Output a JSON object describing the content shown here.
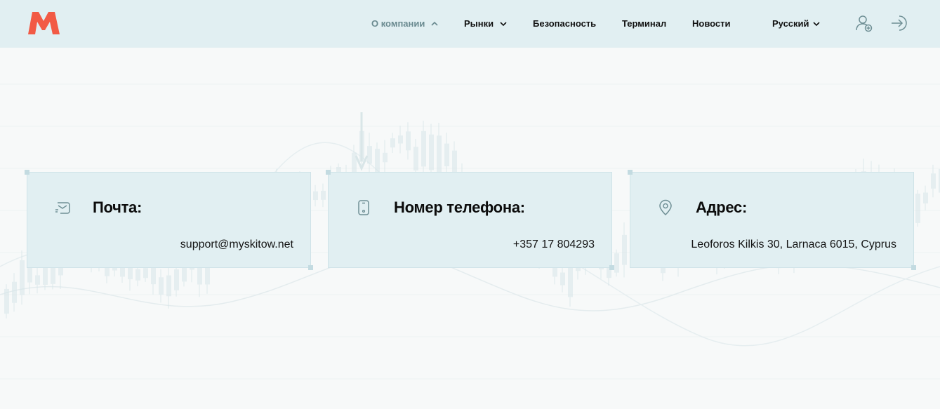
{
  "header": {
    "logo": "logo-m",
    "nav": [
      {
        "label": "О компании",
        "icon": "chevron-up-icon",
        "active": true
      },
      {
        "label": "Рынки",
        "icon": "chevron-down-icon"
      },
      {
        "label": "Безопасность"
      },
      {
        "label": "Терминал"
      },
      {
        "label": "Новости"
      }
    ],
    "language": {
      "label": "Русский",
      "icon": "chevron-down-icon"
    },
    "actions": [
      {
        "icon": "user-add-icon"
      },
      {
        "icon": "login-icon"
      }
    ]
  },
  "contacts": [
    {
      "icon": "mail-icon",
      "title": "Почта:",
      "value": "support@myskitow.net"
    },
    {
      "icon": "phone-icon",
      "title": "Номер телефона:",
      "value": "+357 17 804293"
    },
    {
      "icon": "location-pin-icon",
      "title": "Адрес:",
      "value": "Leoforos Kilkis 30, Larnaca 6015, Cyprus"
    }
  ],
  "colors": {
    "header_bg": "#e1eff2",
    "card_bg": "#e1eff2",
    "logo": "#f25a45",
    "active_nav": "#6a8a90",
    "icon_stroke": "#6f8f95"
  }
}
